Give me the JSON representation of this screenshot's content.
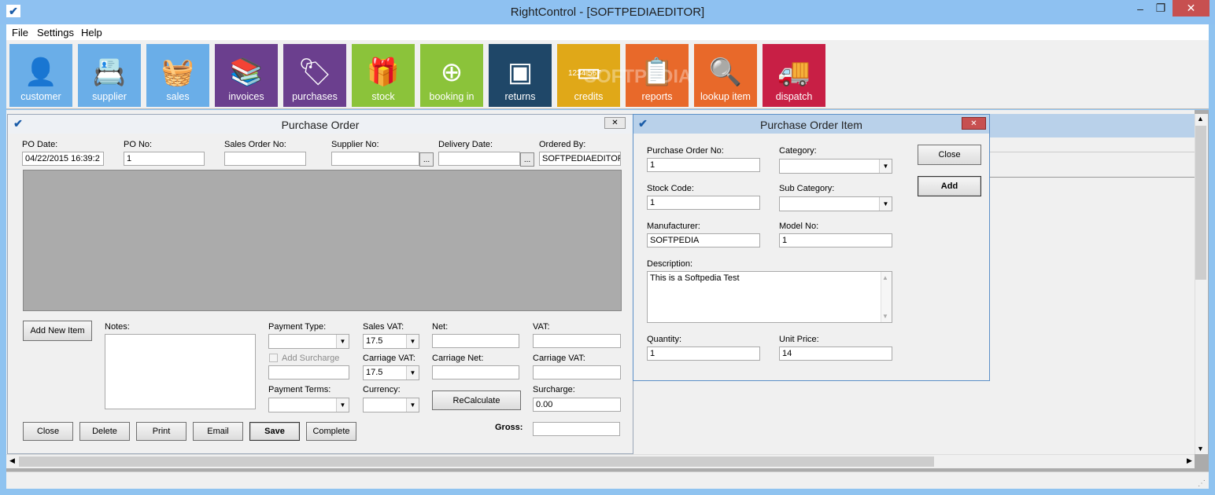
{
  "app": {
    "title": "RightControl - [SOFTPEDIAEDITOR]"
  },
  "menu": {
    "items": [
      "File",
      "Settings",
      "Help"
    ]
  },
  "ribbon": {
    "tiles": [
      {
        "label": "customer",
        "color": "#6aaee8",
        "icon": "customer-icon"
      },
      {
        "label": "supplier",
        "color": "#6aaee8",
        "icon": "supplier-icon"
      },
      {
        "label": "sales",
        "color": "#6aaee8",
        "icon": "basket-icon"
      },
      {
        "label": "invoices",
        "color": "#6b3f8e",
        "icon": "books-icon"
      },
      {
        "label": "purchases",
        "color": "#6b3f8e",
        "icon": "sale-tag-icon"
      },
      {
        "label": "stock",
        "color": "#8bc33a",
        "icon": "gift-icon"
      },
      {
        "label": "booking in",
        "color": "#8bc33a",
        "icon": "plus-circle-icon"
      },
      {
        "label": "returns",
        "color": "#1f4768",
        "icon": "box-icon"
      },
      {
        "label": "credits",
        "color": "#e0a818",
        "icon": "credit-card-icon"
      },
      {
        "label": "reports",
        "color": "#e8692a",
        "icon": "clipboard-icon"
      },
      {
        "label": "lookup item",
        "color": "#e8692a",
        "icon": "magnifier-icon"
      },
      {
        "label": "dispatch",
        "color": "#c81f45",
        "icon": "truck-icon"
      }
    ]
  },
  "card_digits": "1234 567",
  "watermark": "SOFTPEDIA",
  "po": {
    "title": "Purchase Order",
    "po_date_label": "PO Date:",
    "po_date": "04/22/2015 16:39:2",
    "po_no_label": "PO No:",
    "po_no": "1",
    "sales_order_label": "Sales Order No:",
    "sales_order": "",
    "supplier_label": "Supplier No:",
    "supplier": "",
    "delivery_label": "Delivery Date:",
    "delivery": "",
    "ordered_label": "Ordered By:",
    "ordered": "SOFTPEDIAEDITOR",
    "ellipsis": "...",
    "add_item": "Add New Item",
    "notes_label": "Notes:",
    "payment_type_label": "Payment Type:",
    "payment_type": "",
    "add_surcharge": "Add Surcharge",
    "payment_terms_label": "Payment Terms:",
    "payment_terms": "",
    "sales_vat_label": "Sales VAT:",
    "sales_vat": "17.5",
    "carriage_vat_sel_label": "Carriage VAT:",
    "carriage_vat_sel": "17.5",
    "currency_label": "Currency:",
    "currency": "",
    "net_label": "Net:",
    "net": "",
    "carriage_net_label": "Carriage Net:",
    "carriage_net": "",
    "recalculate": "ReCalculate",
    "vat_label": "VAT:",
    "vat": "",
    "carriage_vat_label": "Carriage VAT:",
    "carriage_vat": "",
    "surcharge_label": "Surcharge:",
    "surcharge": "0.00",
    "gross_label": "Gross:",
    "gross": "",
    "buttons": {
      "close": "Close",
      "delete": "Delete",
      "print": "Print",
      "email": "Email",
      "save": "Save",
      "complete": "Complete"
    }
  },
  "poi": {
    "title": "Purchase Order Item",
    "po_no_label": "Purchase Order No:",
    "po_no": "1",
    "category_label": "Category:",
    "category": "",
    "stock_code_label": "Stock Code:",
    "stock_code": "1",
    "sub_category_label": "Sub Category:",
    "sub_category": "",
    "manufacturer_label": "Manufacturer:",
    "manufacturer": "SOFTPEDIA",
    "model_label": "Model No:",
    "model": "1",
    "description_label": "Description:",
    "description": "This is a Softpedia Test",
    "quantity_label": "Quantity:",
    "quantity": "1",
    "unit_price_label": "Unit Price:",
    "unit_price": "14",
    "close": "Close",
    "add": "Add"
  }
}
